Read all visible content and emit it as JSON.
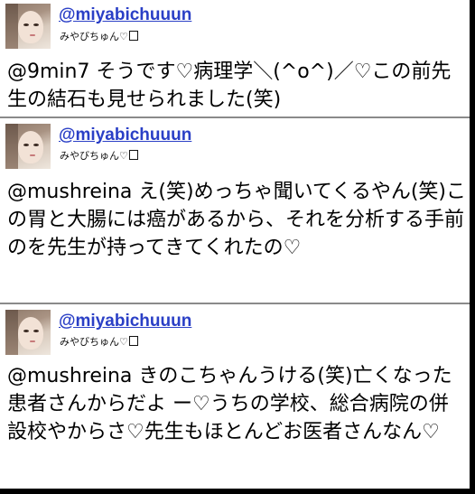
{
  "tweets": [
    {
      "handle": "@miyabichuuun",
      "display_name": "みやびちゅん♡",
      "text": "@9min7 そうです♡病理学＼(^o^)／♡この前先生の結石も見せられました(笑)"
    },
    {
      "handle": "@miyabichuuun",
      "display_name": "みやびちゅん♡",
      "text": "@mushreina え(笑)めっちゃ聞いてくるやん(笑)この胃と大腸には癌があるから、それを分析する手前のを先生が持ってきてくれたの♡"
    },
    {
      "handle": "@miyabichuuun",
      "display_name": "みやびちゅん♡",
      "text": "@mushreina きのこちゃんうける(笑)亡くなった患者さんからだよ ー♡うちの学校、総合病院の併設校やからさ♡先生もほとんどお医者さんなん♡"
    }
  ]
}
